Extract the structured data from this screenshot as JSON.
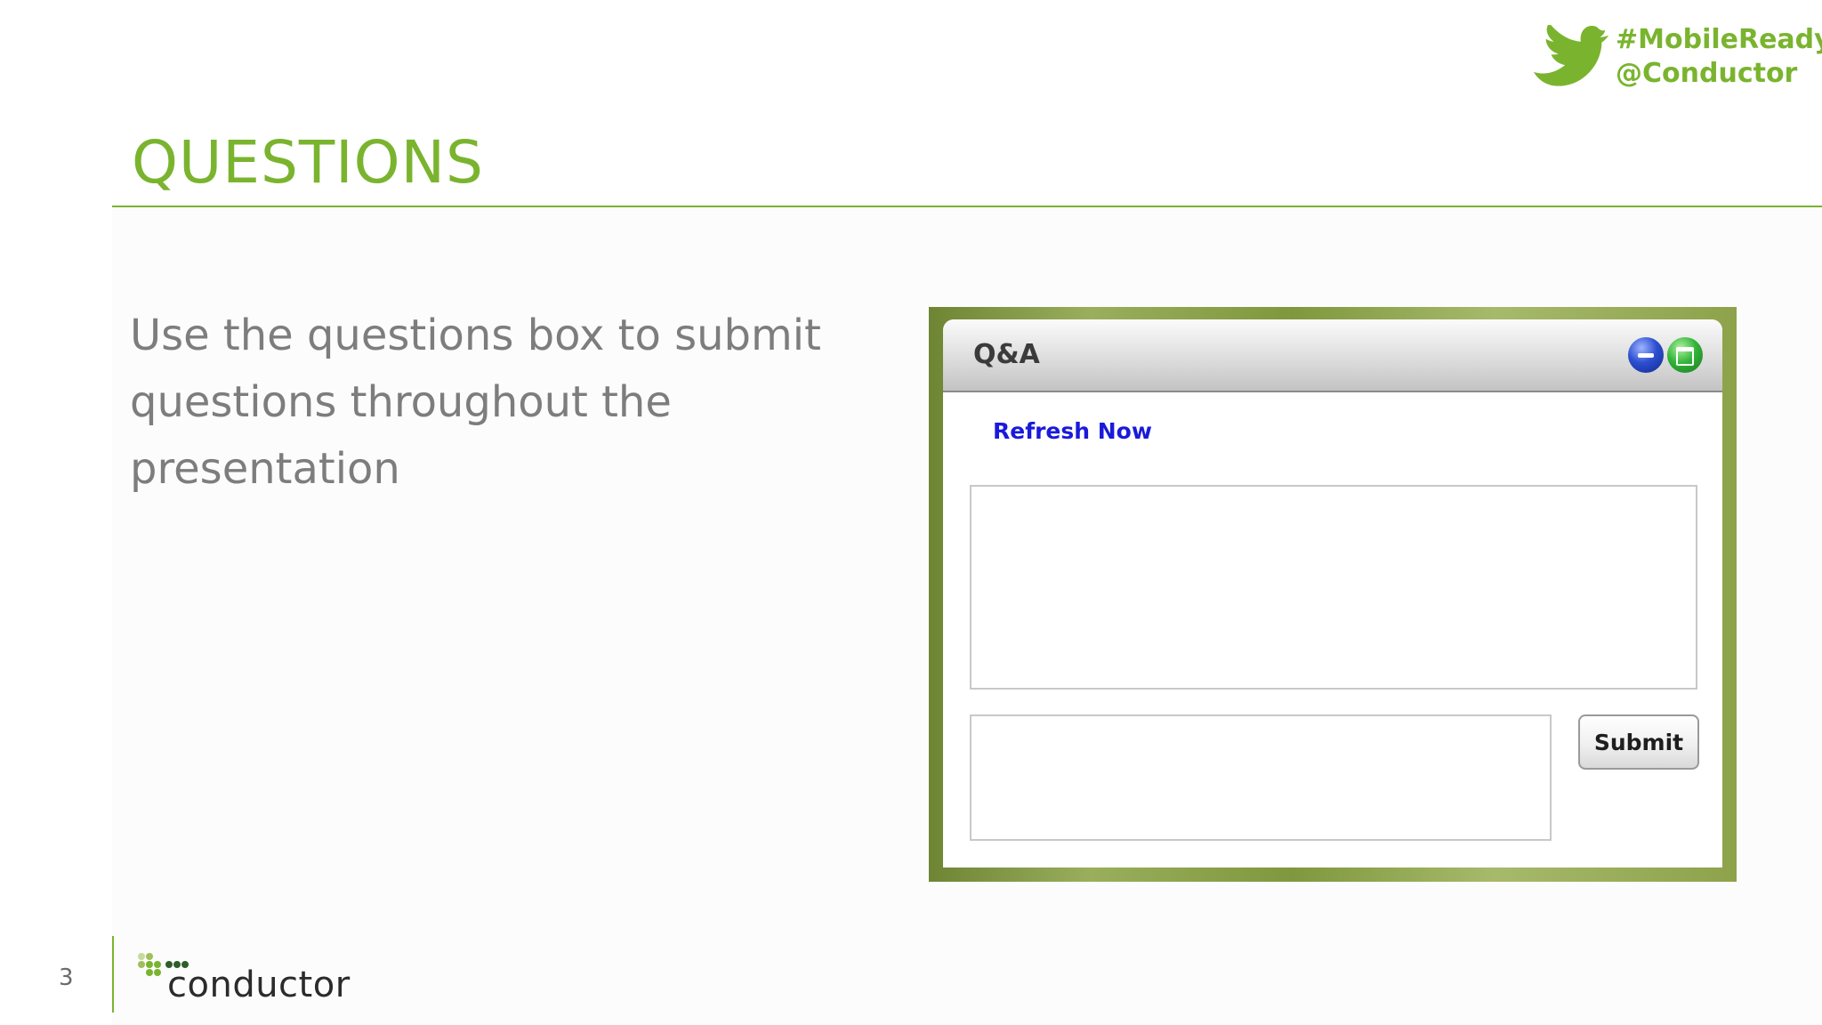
{
  "header": {
    "hashtag": "#MobileReady",
    "twitter_handle": "@Conductor",
    "title": "QUESTIONS"
  },
  "body": {
    "text": "Use the questions box to submit questions throughout the presentation"
  },
  "qa_panel": {
    "title": "Q&A",
    "refresh_label": "Refresh Now",
    "submit_label": "Submit",
    "question_value": ""
  },
  "footer": {
    "page_number": "3",
    "logo_text": "conductor"
  },
  "icons": {
    "twitter": "twitter-bird-icon",
    "minimize": "minimize-icon",
    "maximize": "maximize-icon",
    "logo": "conductor-logo"
  },
  "colors": {
    "accent_green": "#7ab42f",
    "body_text": "#7d7d7d",
    "link_blue": "#1a1adb"
  }
}
